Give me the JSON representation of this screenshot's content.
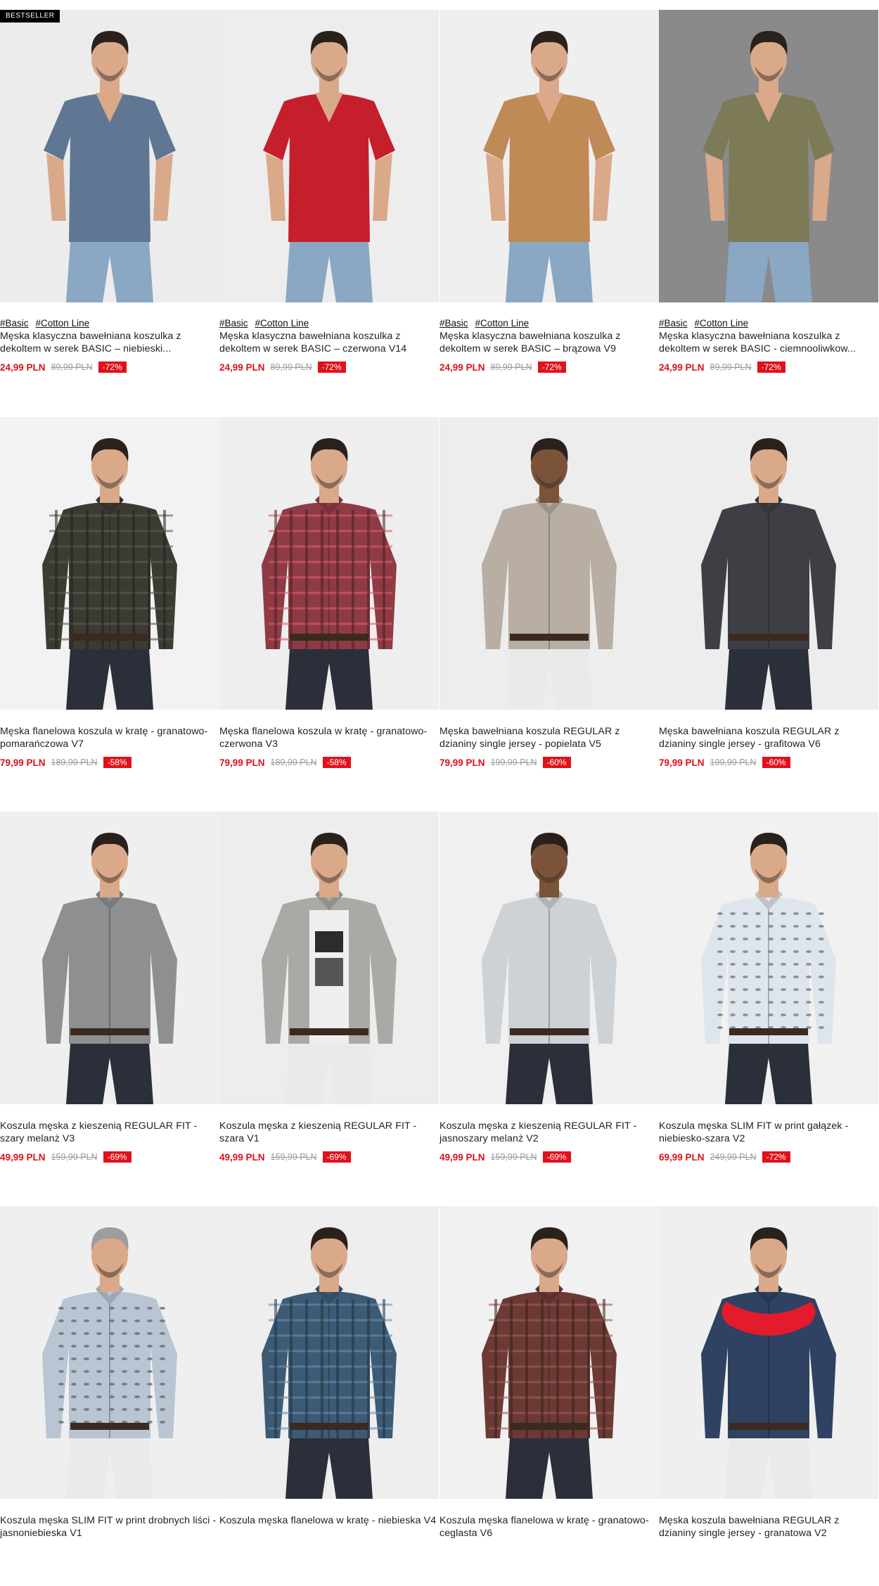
{
  "badge_label": "BESTSELLER",
  "colors": {
    "price": "#d8121b",
    "discount_bg": "#e0111a",
    "badge_bg": "#000000"
  },
  "products": [
    {
      "tags": [
        "#Basic",
        "#Cotton Line"
      ],
      "name": "Męska klasyczna bawełniana koszulka z dekoltem w serek BASIC – niebieski...",
      "price": "24,99 PLN",
      "old_price": "89,99 PLN",
      "discount": "-72%",
      "bestseller": true,
      "garment": "tshirt",
      "color": "#5f7793",
      "bg": "#ececec"
    },
    {
      "tags": [
        "#Basic",
        "#Cotton Line"
      ],
      "name": "Męska klasyczna bawełniana koszulka z dekoltem w serek BASIC – czerwona V14",
      "price": "24,99 PLN",
      "old_price": "89,99 PLN",
      "discount": "-72%",
      "bestseller": false,
      "garment": "tshirt",
      "color": "#c51f2c",
      "bg": "#ededed"
    },
    {
      "tags": [
        "#Basic",
        "#Cotton Line"
      ],
      "name": "Męska klasyczna bawełniana koszulka z dekoltem w serek BASIC – brązowa V9",
      "price": "24,99 PLN",
      "old_price": "89,99 PLN",
      "discount": "-72%",
      "bestseller": false,
      "garment": "tshirt",
      "color": "#c08a56",
      "bg": "#efefef"
    },
    {
      "tags": [
        "#Basic",
        "#Cotton Line"
      ],
      "name": "Męska klasyczna bawełniana koszulka z dekoltem w serek BASIC - ciemnooliwkow...",
      "price": "24,99 PLN",
      "old_price": "89,99 PLN",
      "discount": "-72%",
      "bestseller": false,
      "garment": "tshirt",
      "color": "#7d7a57",
      "bg": "#8a8a8a"
    },
    {
      "tags": [],
      "name": "Męska flanelowa koszula w kratę - granatowo-pomarańczowa V7",
      "price": "79,99 PLN",
      "old_price": "189,99 PLN",
      "discount": "-58%",
      "bestseller": false,
      "garment": "plaid",
      "color": "#3c3b33",
      "bg": "#f2f2f2"
    },
    {
      "tags": [],
      "name": "Męska flanelowa koszula w kratę - granatowo-czerwona V3",
      "price": "79,99 PLN",
      "old_price": "189,99 PLN",
      "discount": "-58%",
      "bestseller": false,
      "garment": "plaid",
      "color": "#8e3b45",
      "bg": "#eeeeee"
    },
    {
      "tags": [],
      "name": "Męska bawełniana koszula REGULAR z dzianiny single jersey - popielata V5",
      "price": "79,99 PLN",
      "old_price": "199,99 PLN",
      "discount": "-60%",
      "bestseller": false,
      "garment": "shirt",
      "color": "#b8aea4",
      "bg": "#ededed"
    },
    {
      "tags": [],
      "name": "Męska bawełniana koszula REGULAR z dzianiny single jersey - grafitowa V6",
      "price": "79,99 PLN",
      "old_price": "199,99 PLN",
      "discount": "-60%",
      "bestseller": false,
      "garment": "shirt",
      "color": "#3d3f44",
      "bg": "#ededed"
    },
    {
      "tags": [],
      "name": "Koszula męska z kieszenią REGULAR FIT - szary melanż V3",
      "price": "49,99 PLN",
      "old_price": "159,99 PLN",
      "discount": "-69%",
      "bestseller": false,
      "garment": "shirt",
      "color": "#8d8f91",
      "bg": "#efefef"
    },
    {
      "tags": [],
      "name": "Koszula męska z kieszenią REGULAR FIT - szara V1",
      "price": "49,99 PLN",
      "old_price": "159,99 PLN",
      "discount": "-69%",
      "bestseller": false,
      "garment": "overshirt",
      "color": "#a9a9a6",
      "bg": "#ededed"
    },
    {
      "tags": [],
      "name": "Koszula męska z kieszenią REGULAR FIT - jasnoszary melanż V2",
      "price": "49,99 PLN",
      "old_price": "159,99 PLN",
      "discount": "-69%",
      "bestseller": false,
      "garment": "shirt",
      "color": "#cdd2d6",
      "bg": "#f0f0f0"
    },
    {
      "tags": [],
      "name": "Koszula męska SLIM FIT w print gałązek - niebiesko-szara V2",
      "price": "69,99 PLN",
      "old_price": "249,99 PLN",
      "discount": "-72%",
      "bestseller": false,
      "garment": "print",
      "color": "#dfe5ec",
      "bg": "#f1f1f1"
    },
    {
      "tags": [],
      "name": "Koszula męska SLIM FIT w print drobnych liści - jasnoniebieska V1",
      "price": "",
      "old_price": "",
      "discount": "",
      "bestseller": false,
      "garment": "print",
      "color": "#b9c5d2",
      "bg": "#efefef"
    },
    {
      "tags": [],
      "name": "Koszula męska flanelowa w kratę - niebieska V4",
      "price": "",
      "old_price": "",
      "discount": "",
      "bestseller": false,
      "garment": "plaid",
      "color": "#3d5b74",
      "bg": "#eeeeee"
    },
    {
      "tags": [],
      "name": "Koszula męska flanelowa w kratę - granatowo-ceglasta V6",
      "price": "",
      "old_price": "",
      "discount": "",
      "bestseller": false,
      "garment": "plaid",
      "color": "#6b3a35",
      "bg": "#f1f1f1"
    },
    {
      "tags": [],
      "name": "Męska koszula bawełniana REGULAR z dzianiny single jersey - granatowa V2",
      "price": "",
      "old_price": "",
      "discount": "",
      "bestseller": false,
      "garment": "sweater",
      "color": "#2f4261",
      "bg": "#efefef"
    }
  ]
}
